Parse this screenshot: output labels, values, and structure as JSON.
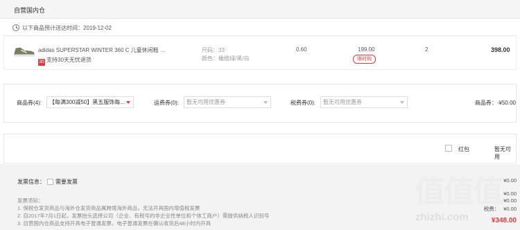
{
  "section": {
    "title": "自营国内仓"
  },
  "delivery": {
    "text": "以下商品预计送达时间：2019-12-02"
  },
  "product": {
    "name": "adidas SUPERSTAR WINTER 360 C 儿童休闲鞋 ...",
    "service_badge": "30",
    "service_text": "支持30天无忧退货",
    "size": "尺码：33",
    "color": "颜色：橄榄绿/黑/白",
    "rate": "0.60",
    "price": "199.00",
    "flash_tag": "限时购",
    "qty": "2",
    "total": "398.00"
  },
  "coupons": {
    "goods_label": "商品券(4):",
    "goods_value": "【每满300减50】黑五服饰每...",
    "shipping_label": "运费券(0):",
    "shipping_placeholder": "暂无可用优惠券",
    "tax_label": "税费券(0):",
    "tax_placeholder": "暂无可用优惠券",
    "goods_amount": "商品券：-¥50.00"
  },
  "redpacket": {
    "label": "红包",
    "status": "暂无可用"
  },
  "invoice": {
    "label": "发票信息：",
    "need_label": "需要发票",
    "notice": [
      "发票须知：",
      "1. 保税仓发货商品与海外仓发货商品属跨境海外商品，无法开具国内增值税发票",
      "2. 自2017年7月1日起，发票抬头选择公司（企业、有税号的非企业性单位和个体工商户）需提供纳税人识别号",
      "3. 自营国内仓商品支持开具电子普通发票，电子普通发票在确认收货后48小时内开具"
    ]
  },
  "summary": {
    "rows": [
      {
        "label": "",
        "value": "¥0.00"
      },
      {
        "label": "",
        "value": "¥0.00"
      },
      {
        "label": "",
        "value": "¥0.00"
      },
      {
        "label": "税费：",
        "value": "¥0.00"
      }
    ],
    "total": "¥348.00"
  },
  "watermark": {
    "text": "zhizhi.com"
  },
  "colors": {
    "accent": "#e4393c",
    "header_bg": "#f5f5f5",
    "footer_bg": "#f3f3f3"
  }
}
